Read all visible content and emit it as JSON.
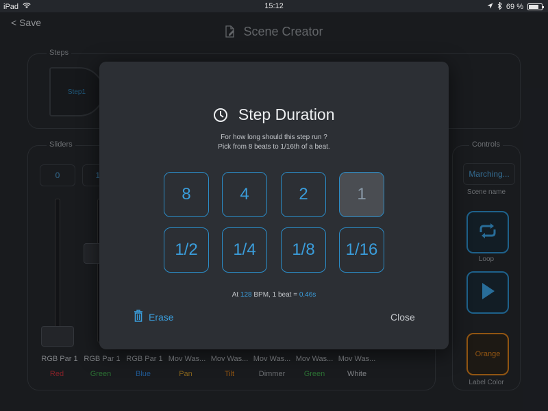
{
  "status": {
    "device": "iPad",
    "time": "15:12",
    "battery": "69 %"
  },
  "nav": {
    "back": "< Save",
    "title": "Scene Creator"
  },
  "steps": {
    "label": "Steps",
    "step1": "Step1"
  },
  "sliders": {
    "label": "Sliders",
    "values": [
      "0",
      "16"
    ],
    "channels": [
      {
        "name": "RGB Par 1",
        "color": "Red",
        "hex": "#c2303a"
      },
      {
        "name": "RGB Par 1",
        "color": "Green",
        "hex": "#3fa14a"
      },
      {
        "name": "RGB Par 1",
        "color": "Blue",
        "hex": "#2f7fd0"
      },
      {
        "name": "Mov Was...",
        "color": "Pan",
        "hex": "#c0902a"
      },
      {
        "name": "Mov Was...",
        "color": "Tilt",
        "hex": "#d07a1a"
      },
      {
        "name": "Mov Was...",
        "color": "Dimmer",
        "hex": "#9a9ea3"
      },
      {
        "name": "Mov Was...",
        "color": "Green",
        "hex": "#3fa14a"
      },
      {
        "name": "Mov Was...",
        "color": "White",
        "hex": "#b7bbc0"
      }
    ]
  },
  "controls": {
    "label": "Controls",
    "scene_value": "Marching...",
    "scene_caption": "Scene name",
    "loop": "Loop",
    "label_color_value": "Orange",
    "label_color_caption": "Label Color"
  },
  "modal": {
    "title": "Step Duration",
    "sub1": "For how long should this step run ?",
    "sub2": "Pick from 8 beats to 1/16th of a beat.",
    "durations": [
      "8",
      "4",
      "2",
      "1",
      "1/2",
      "1/4",
      "1/8",
      "1/16"
    ],
    "selected": "1",
    "bpm_prefix": "At ",
    "bpm_value": "128",
    "bpm_mid": " BPM, 1 beat = ",
    "beat_value": "0.46s",
    "erase": "Erase",
    "close": "Close"
  }
}
